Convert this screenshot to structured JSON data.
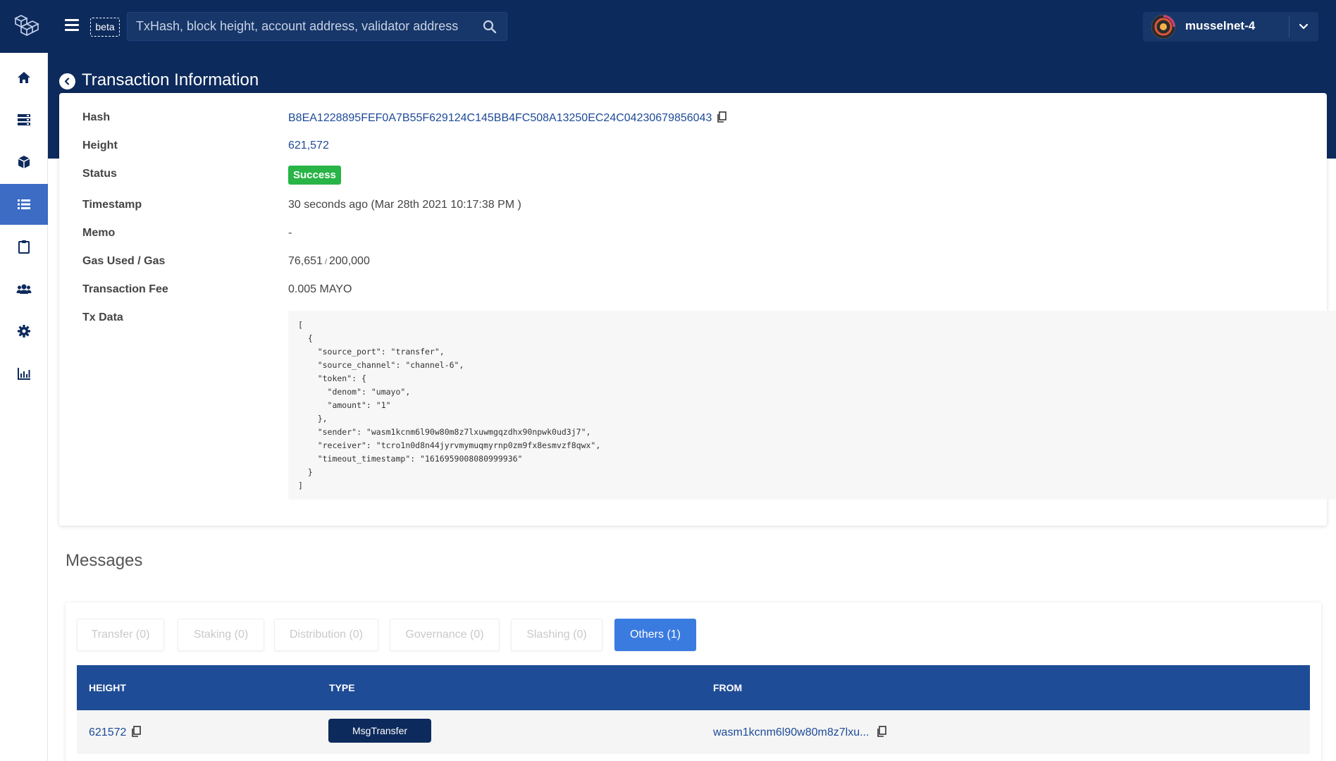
{
  "header": {
    "beta_label": "beta",
    "search_placeholder": "TxHash, block height, account address, validator address",
    "network_name": "musselnet-4"
  },
  "sidebar": {
    "items": [
      {
        "name": "home",
        "icon": "home-icon"
      },
      {
        "name": "blocks",
        "icon": "server-icon"
      },
      {
        "name": "contracts",
        "icon": "cube-icon"
      },
      {
        "name": "transactions",
        "icon": "list-icon",
        "active": true
      },
      {
        "name": "proposals",
        "icon": "clipboard-icon"
      },
      {
        "name": "validators",
        "icon": "users-icon"
      },
      {
        "name": "parameters",
        "icon": "gear-icon"
      },
      {
        "name": "statistics",
        "icon": "chart-icon"
      }
    ]
  },
  "page": {
    "title": "Transaction Information"
  },
  "tx": {
    "labels": {
      "hash": "Hash",
      "height": "Height",
      "status": "Status",
      "timestamp": "Timestamp",
      "memo": "Memo",
      "gas": "Gas Used / Gas",
      "fee": "Transaction Fee",
      "data": "Tx Data"
    },
    "hash": "B8EA1228895FEF0A7B55F629124C145BB4FC508A13250EC24C04230679856043",
    "height": "621,572",
    "status": "Success",
    "timestamp": "30 seconds ago (Mar 28th 2021 10:17:38 PM )",
    "memo": "-",
    "gas_used": "76,651",
    "gas_separator": "/",
    "gas_wanted": "200,000",
    "fee": "0.005 MAYO",
    "data": "[\n  {\n    \"source_port\": \"transfer\",\n    \"source_channel\": \"channel-6\",\n    \"token\": {\n      \"denom\": \"umayo\",\n      \"amount\": \"1\"\n    },\n    \"sender\": \"wasm1kcnm6l90w80m8z7lxuwmgqzdhx90npwk0ud3j7\",\n    \"receiver\": \"tcro1n0d8n44jyrvmymuqmyrnp0zm9fx8esmvzf8qwx\",\n    \"timeout_timestamp\": \"1616959008080999936\"\n  }\n]"
  },
  "messages": {
    "title": "Messages",
    "tabs": [
      {
        "label": "Transfer (0)"
      },
      {
        "label": "Staking (0)"
      },
      {
        "label": "Distribution (0)"
      },
      {
        "label": "Governance (0)"
      },
      {
        "label": "Slashing (0)"
      },
      {
        "label": "Others (1)",
        "active": true
      }
    ],
    "columns": [
      "HEIGHT",
      "TYPE",
      "FROM"
    ],
    "rows": [
      {
        "height": "621572",
        "type": "MsgTransfer",
        "from": "wasm1kcnm6l90w80m8z7lxu..."
      }
    ]
  },
  "colors": {
    "header_bg": "#0d2a5c",
    "active_sidebar": "#3c6cc4",
    "success": "#28b446",
    "active_tab": "#3a7be0",
    "table_header": "#1f4c96",
    "link": "#1d4a98"
  }
}
